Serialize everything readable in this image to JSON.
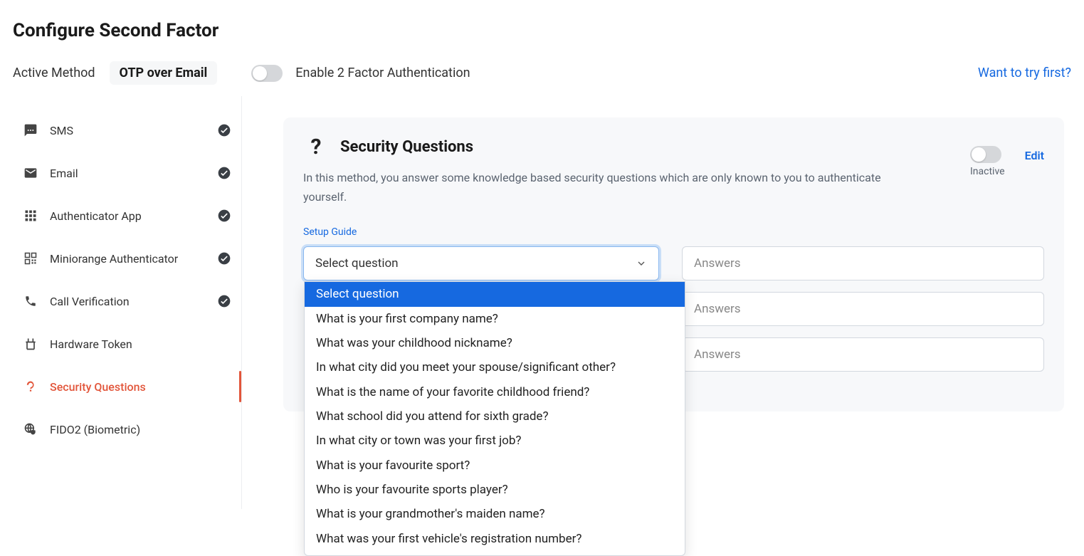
{
  "page_title": "Configure Second Factor",
  "topbar": {
    "active_method_label": "Active Method",
    "active_method_value": "OTP over Email",
    "toggle_label": "Enable 2 Factor Authentication",
    "toggle_on": false,
    "try_first": "Want to try first?"
  },
  "sidebar": {
    "items": [
      {
        "icon": "sms",
        "label": "SMS",
        "checked": true
      },
      {
        "icon": "email",
        "label": "Email",
        "checked": true
      },
      {
        "icon": "grid",
        "label": "Authenticator App",
        "checked": true
      },
      {
        "icon": "qr",
        "label": "Miniorange Authenticator",
        "checked": true
      },
      {
        "icon": "phone",
        "label": "Call Verification",
        "checked": true
      },
      {
        "icon": "token",
        "label": "Hardware Token",
        "checked": false
      },
      {
        "icon": "question",
        "label": "Security Questions",
        "checked": false,
        "active": true
      },
      {
        "icon": "fido",
        "label": "FIDO2 (Biometric)",
        "checked": false
      }
    ]
  },
  "panel": {
    "title": "Security Questions",
    "desc": "In this method, you answer some knowledge based security questions which are only known to you to authenticate yourself.",
    "status_label": "Inactive",
    "status_on": false,
    "edit": "Edit",
    "setup_guide": "Setup Guide",
    "select_placeholder": "Select question",
    "answer_placeholder": "Answers",
    "dropdown_options": [
      "Select question",
      "What is your first company name?",
      "What was your childhood nickname?",
      "In what city did you meet your spouse/significant other?",
      "What is the name of your favorite childhood friend?",
      "What school did you attend for sixth grade?",
      "In what city or town was your first job?",
      "What is your favourite sport?",
      "Who is your favourite sports player?",
      "What is your grandmother's maiden name?",
      "What was your first vehicle's registration number?"
    ]
  }
}
